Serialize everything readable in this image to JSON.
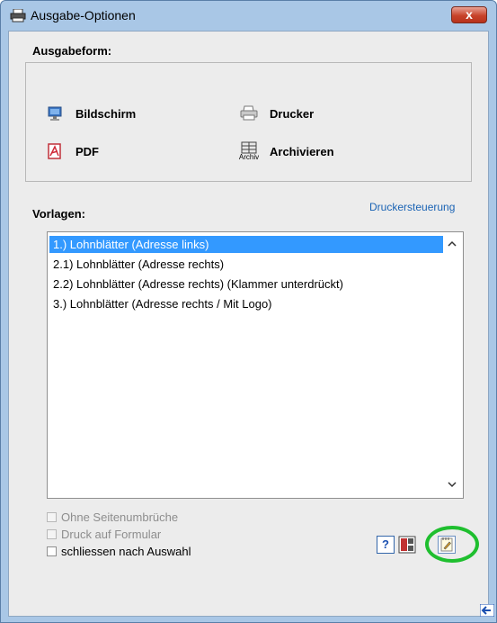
{
  "window": {
    "title": "Ausgabe-Optionen",
    "close_label": "x"
  },
  "output_group": {
    "label": "Ausgabeform:",
    "options": [
      {
        "label": "Bildschirm",
        "icon": "monitor-icon"
      },
      {
        "label": "Drucker",
        "icon": "printer-icon"
      },
      {
        "label": "PDF",
        "icon": "pdf-icon"
      },
      {
        "label": "Archivieren",
        "icon": "archive-icon",
        "icon_caption": "Archiv"
      }
    ]
  },
  "templates": {
    "label": "Vorlagen:",
    "printer_control_link": "Druckersteuerung",
    "items": [
      "1.) Lohnblätter (Adresse links)",
      "2.1) Lohnblätter (Adresse rechts)",
      "2.2) Lohnblätter (Adresse rechts) (Klammer unterdrückt)",
      "3.) Lohnblätter (Adresse rechts / Mit Logo)"
    ],
    "selected_index": 0
  },
  "checkboxes": [
    {
      "label": "Ohne Seitenumbrüche",
      "checked": false,
      "enabled": false
    },
    {
      "label": "Druck auf Formular",
      "checked": false,
      "enabled": false
    },
    {
      "label": "schliessen nach Auswahl",
      "checked": false,
      "enabled": true
    }
  ],
  "toolbar": {
    "help_label": "?"
  },
  "colors": {
    "selection": "#3399ff",
    "link": "#1a63b4",
    "highlight_circle": "#1fbf2f",
    "titlebar": "#a9c7e6"
  }
}
